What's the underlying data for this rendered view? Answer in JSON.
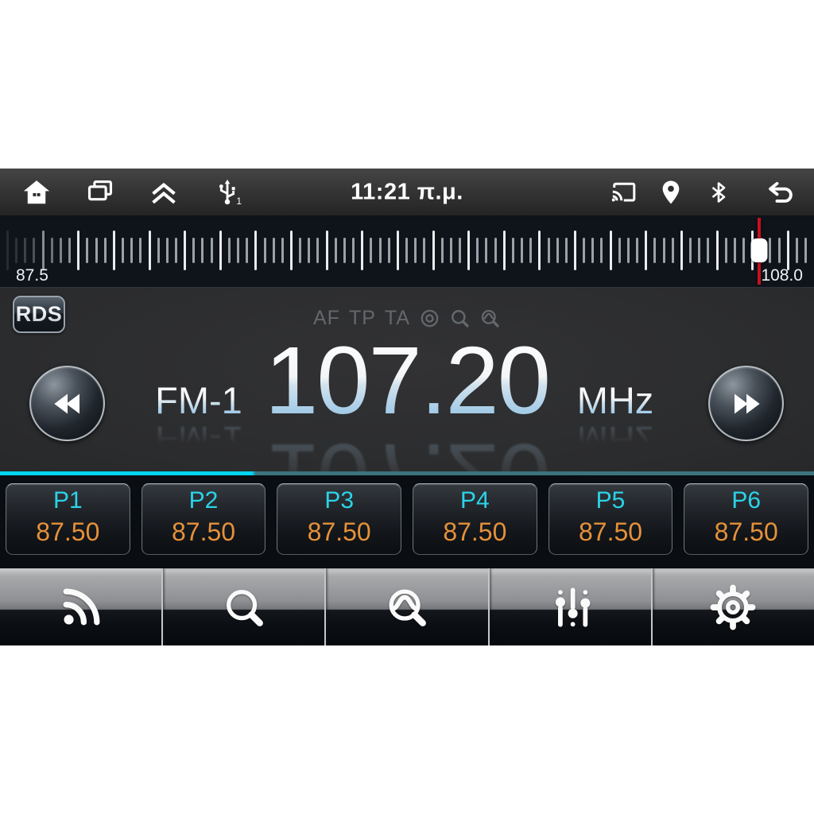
{
  "status_bar": {
    "time": "11:21 π.μ.",
    "usb_badge": "1",
    "icons_left": [
      "home-icon",
      "recent-apps-icon",
      "collapse-up-icon",
      "usb-icon"
    ],
    "icons_right": [
      "cast-icon",
      "location-icon",
      "bluetooth-icon",
      "back-icon"
    ]
  },
  "tuner_scale": {
    "min_label": "87.5",
    "max_label": "108.0",
    "marker_pct": 93.3,
    "tick_count": 91,
    "major_every": 4,
    "fade_in_ticks": 9
  },
  "radio": {
    "rds_label": "RDS",
    "indicators": [
      "AF",
      "TP",
      "TA"
    ],
    "indicator_icons": [
      "pty-icon",
      "search-indicator-icon",
      "scan-indicator-icon"
    ],
    "band_label": "FM-1",
    "frequency": "107.20",
    "unit_label": "MHz"
  },
  "presets": [
    {
      "label": "P1",
      "value": "87.50"
    },
    {
      "label": "P2",
      "value": "87.50"
    },
    {
      "label": "P3",
      "value": "87.50"
    },
    {
      "label": "P4",
      "value": "87.50"
    },
    {
      "label": "P5",
      "value": "87.50"
    },
    {
      "label": "P6",
      "value": "87.50"
    }
  ],
  "toolbar": {
    "items": [
      "broadcast-icon",
      "search-icon",
      "scan-icon",
      "equalizer-icon",
      "settings-icon"
    ]
  },
  "colors": {
    "accent_cyan": "#00d3ee",
    "accent_cyan_dim": "#3b737e",
    "preset_label_cyan": "#2bd3e8",
    "preset_value_orange": "#e5913a",
    "marker_red": "#c8101e",
    "freq_gradient_blue": "#93c2e2",
    "ruler_bg": "#0f141b",
    "main_bg": "#2c2d2f",
    "preset_area_bg": "#0a0d11"
  }
}
